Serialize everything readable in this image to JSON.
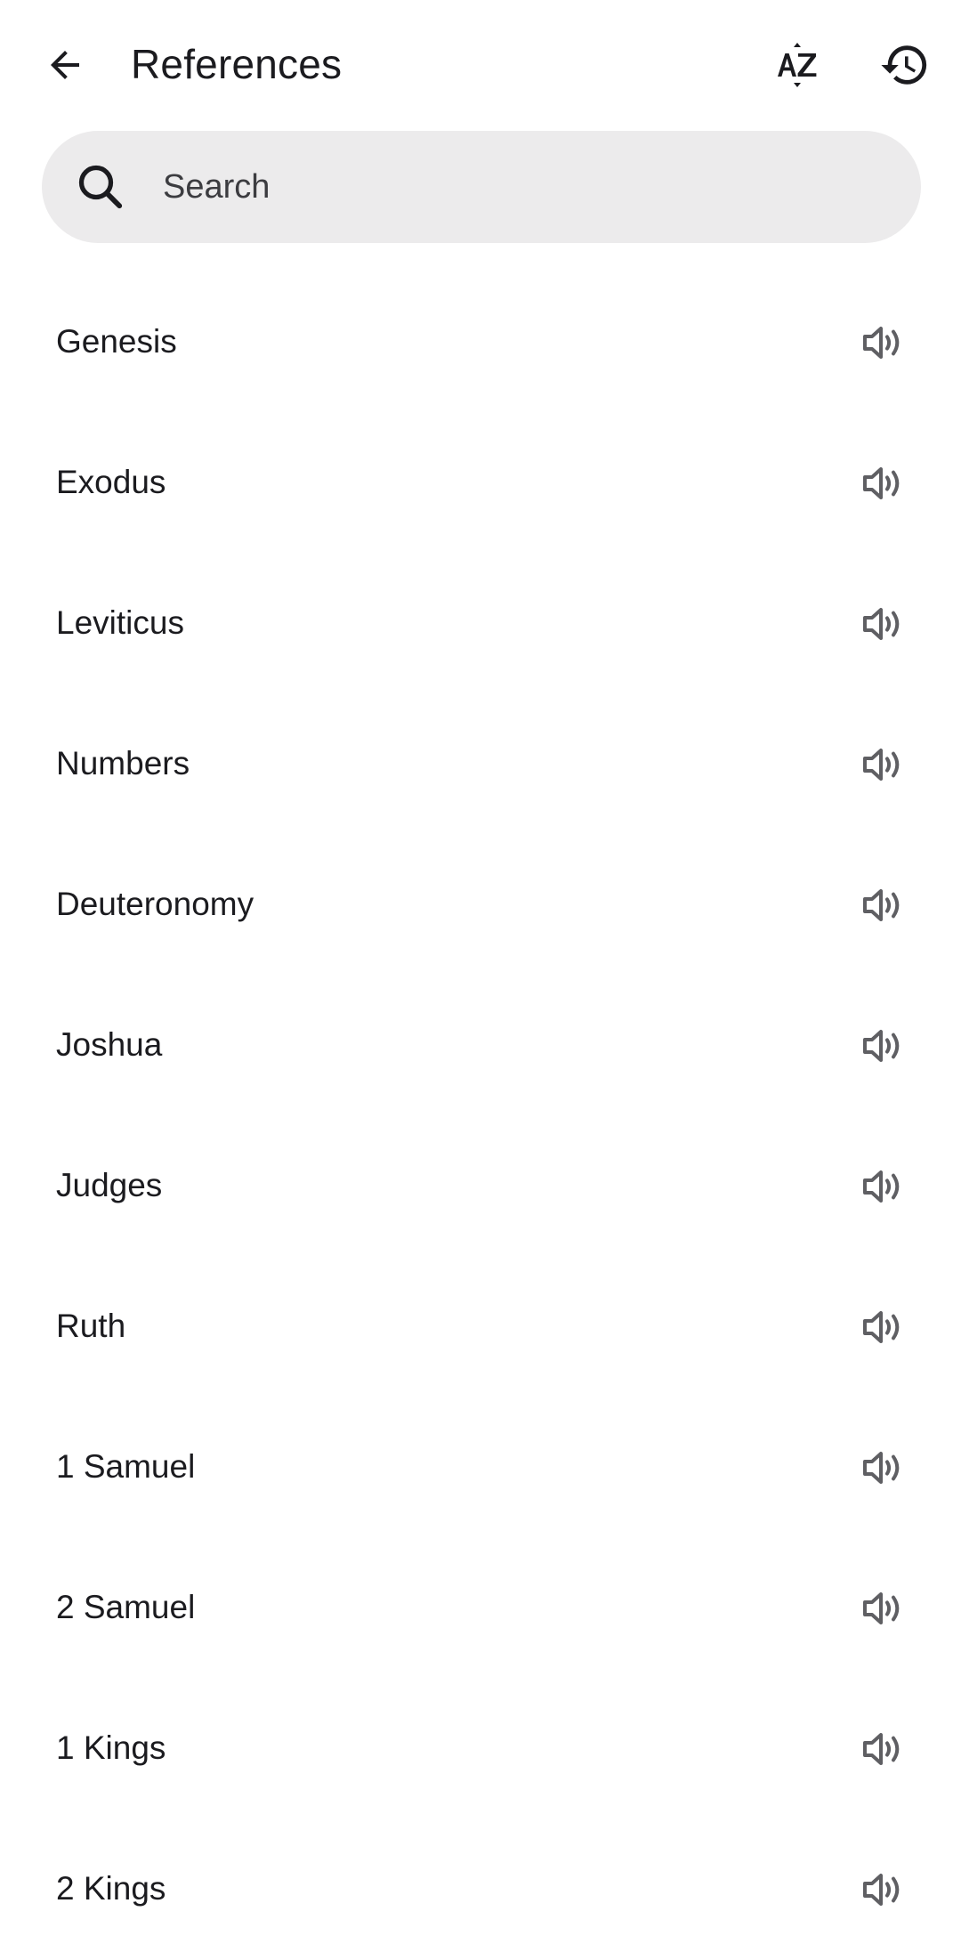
{
  "header": {
    "title": "References",
    "back_icon": "arrow-back-icon",
    "sort_icon": "sort-az-icon",
    "history_icon": "history-icon"
  },
  "search": {
    "placeholder": "Search",
    "value": "",
    "icon": "search-icon"
  },
  "books": [
    {
      "label": "Genesis"
    },
    {
      "label": "Exodus"
    },
    {
      "label": "Leviticus"
    },
    {
      "label": "Numbers"
    },
    {
      "label": "Deuteronomy"
    },
    {
      "label": "Joshua"
    },
    {
      "label": "Judges"
    },
    {
      "label": "Ruth"
    },
    {
      "label": "1 Samuel"
    },
    {
      "label": "2 Samuel"
    },
    {
      "label": "1 Kings"
    },
    {
      "label": "2 Kings"
    }
  ],
  "row_icon": "speaker-icon",
  "colors": {
    "background": "#ffffff",
    "search_bg": "#ecebec",
    "text": "#1b1b1f",
    "icon_gray": "#5f5f63"
  }
}
